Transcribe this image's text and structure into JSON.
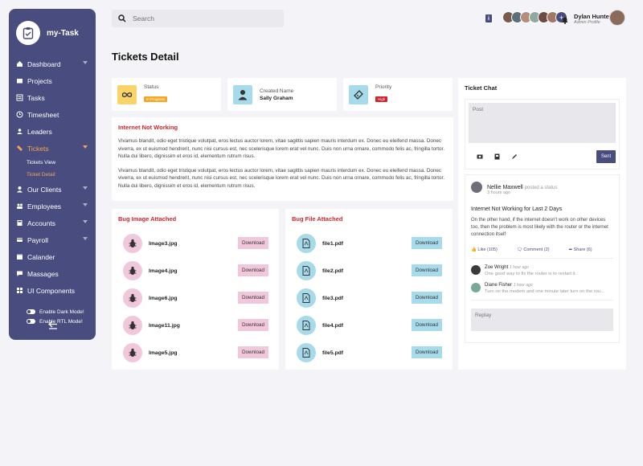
{
  "app": {
    "name": "my-Task"
  },
  "sidebar": {
    "items": [
      {
        "label": "Dashboard",
        "has_caret": true
      },
      {
        "label": "Projects",
        "has_caret": false
      },
      {
        "label": "Tasks",
        "has_caret": false
      },
      {
        "label": "Timesheet",
        "has_caret": false
      },
      {
        "label": "Leaders",
        "has_caret": false
      },
      {
        "label": "Tickets",
        "has_caret": true,
        "active": true
      },
      {
        "label": "Our Clients",
        "has_caret": true
      },
      {
        "label": "Employees",
        "has_caret": true
      },
      {
        "label": "Accounts",
        "has_caret": true
      },
      {
        "label": "Payroll",
        "has_caret": true
      },
      {
        "label": "Calander",
        "has_caret": false
      },
      {
        "label": "Massages",
        "has_caret": false
      },
      {
        "label": "UI Components",
        "has_caret": false
      }
    ],
    "sub_items": [
      "Tickets View",
      "Ticket Detail"
    ],
    "toggles": [
      "Enable Dark Mode!",
      "Enable RTL Mode!"
    ]
  },
  "header": {
    "search_placeholder": "Search",
    "user_name": "Dylan Hunter",
    "user_role": "Admin Profile",
    "more_label": "+"
  },
  "page": {
    "title": "Tickets Detail"
  },
  "stats": {
    "status": {
      "label": "Status",
      "value": "In Progress",
      "color": "#f5a623"
    },
    "created": {
      "label": "Created Name",
      "value": "Sally Graham"
    },
    "priority": {
      "label": "Priority",
      "value": "High",
      "color": "#d1222c"
    }
  },
  "description": {
    "title": "Internet Not Working",
    "para1": "Vivamus blandit, odio eget tristique volutpat, eros lectus auctor lorem, vitae sagittis sapien mauris interdum ex. Donec eu eleifend massa. Donec viverra, ex ut euismod hendrerit, nunc nisi cursus est, nec scelerisque lorem erat vel nunc. Duis non urna ornare, commodo felis ac, fringilla tortor. Nulla dui libero, dignissim et eros id, elementum rutrum risus.",
    "para2": "Vivamus blandit, odio eget tristique volutpat, eros lectus auctor lorem, vitae sagittis sapien mauris interdum ex. Donec eu eleifend massa. Donec viverra, ex ut euismod hendrerit, nunc nisi cursus est, nec scelerisque lorem erat vel nunc. Duis non urna ornare, commodo felis ac, fringilla tortor. Nulla dui libero, dignissim et eros id, elementum rutrum risus."
  },
  "bug_images": {
    "title": "Bug Image Attached",
    "download_label": "Download",
    "files": [
      "Image3.jpg",
      "Image4.jpg",
      "Image6.jpg",
      "Image11.jpg",
      "Image5.jpg"
    ]
  },
  "bug_files": {
    "title": "Bug File Attached",
    "download_label": "Download",
    "files": [
      "file1.pdf",
      "file2.pdf",
      "file3.pdf",
      "file4.pdf",
      "file5.pdf"
    ]
  },
  "chat": {
    "title": "Ticket Chat",
    "post_placeholder": "Post",
    "sent_label": "Sent",
    "post": {
      "author": "Nellie Maxwell",
      "action": "posted a status",
      "time": "3 hours ago",
      "title": "Internet Not Working for Last 2 Days",
      "body": "On the other hand, if the internet doesn't work on other devices too, then the problem is most likely with the router or the internet connection itself",
      "like": "Like (105)",
      "comment": "Comment (2)",
      "share": "Share (6)"
    },
    "comments": [
      {
        "name": "Zoe Wright",
        "time": "1 hour ago",
        "text": "One good way to fix the router is to restart it."
      },
      {
        "name": "Diane Fisher",
        "time": "1 hour ago",
        "text": "Turn on the modem and one minute later turn on the rou..."
      }
    ],
    "replay_placeholder": "Replay"
  },
  "colors": {
    "sidebar": "#484c7f",
    "accent": "#f5a25d",
    "danger": "#d1222c",
    "pink": "#f1c8db",
    "teal": "#a7daea"
  }
}
